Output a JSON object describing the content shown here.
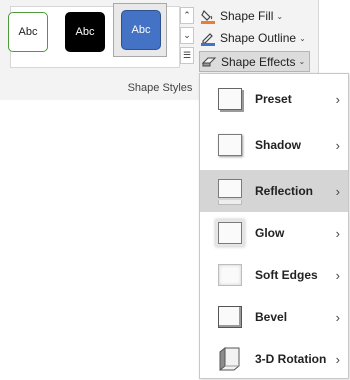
{
  "gallery": {
    "swatches": [
      {
        "label": "Abc",
        "style": "white outline"
      },
      {
        "label": "Abc",
        "style": "black fill"
      },
      {
        "label": "Abc",
        "style": "blue fill",
        "selected": true
      }
    ],
    "scroll_up_glyph": "⌃",
    "scroll_down_glyph": "⌄",
    "more_glyph": "☰"
  },
  "group_label": "Shape Styles",
  "commands": {
    "fill": {
      "label": "Shape Fill",
      "caret": "⌄",
      "icon": "paint-bucket-icon"
    },
    "outline": {
      "label": "Shape Outline",
      "caret": "⌄",
      "icon": "pencil-icon"
    },
    "effects": {
      "label": "Shape Effects",
      "caret": "⌄",
      "icon": "shape-effects-icon"
    }
  },
  "menu": {
    "items": [
      {
        "label": "Preset",
        "arrow": "›"
      },
      {
        "label": "Shadow",
        "arrow": "›"
      },
      {
        "label": "Reflection",
        "arrow": "›",
        "highlighted": true
      },
      {
        "label": "Glow",
        "arrow": "›"
      },
      {
        "label": "Soft Edges",
        "arrow": "›"
      },
      {
        "label": "Bevel",
        "arrow": "›"
      },
      {
        "label": "3-D Rotation",
        "arrow": "›"
      }
    ]
  },
  "colors": {
    "accent_blue": "#4472c4",
    "outline_green": "#4f9a3a",
    "highlight": "#d5d5d5"
  }
}
